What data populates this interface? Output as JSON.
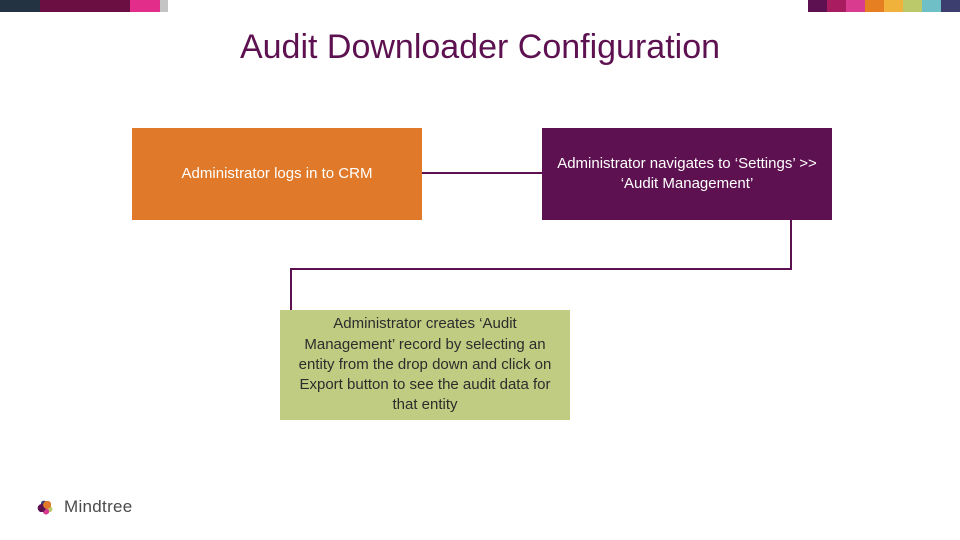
{
  "title": "Audit Downloader Configuration",
  "steps": {
    "step1": "Administrator logs in to CRM",
    "step2": "Administrator navigates to ‘Settings’ >> ‘Audit Management’",
    "step3": "Administrator creates ‘Audit Management’ record by selecting an entity from the drop down and click on Export button to see the audit data for that entity"
  },
  "logo_text": "Mindtree",
  "colors": {
    "accent_purple": "#5e1150",
    "accent_orange": "#e07a2a",
    "accent_olive": "#c0cc82"
  }
}
